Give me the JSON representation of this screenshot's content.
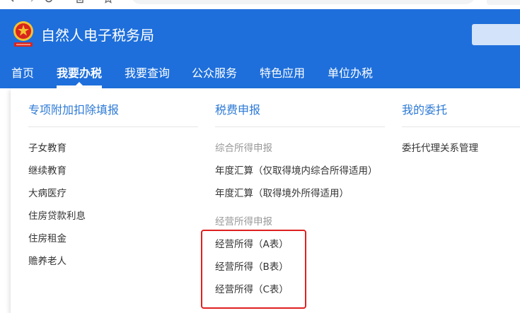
{
  "browser": {
    "icons": [
      "back-arrow-icon",
      "forward-arrow-icon",
      "reload-icon",
      "page-info-icon",
      "bookmark-star-icon"
    ]
  },
  "header": {
    "title": "自然人电子税务局",
    "logo_icon": "national-emblem-icon"
  },
  "nav": {
    "items": [
      {
        "label": "首页",
        "active": false
      },
      {
        "label": "我要办税",
        "active": true
      },
      {
        "label": "我要查询",
        "active": false
      },
      {
        "label": "公众服务",
        "active": false
      },
      {
        "label": "特色应用",
        "active": false
      },
      {
        "label": "单位办税",
        "active": false
      }
    ]
  },
  "menu": {
    "columns": [
      {
        "heading": "专项附加扣除填报",
        "items": [
          {
            "label": "子女教育"
          },
          {
            "label": "继续教育"
          },
          {
            "label": "大病医疗"
          },
          {
            "label": "住房贷款利息"
          },
          {
            "label": "住房租金"
          },
          {
            "label": "赡养老人"
          }
        ]
      },
      {
        "heading": "税费申报",
        "groups": [
          {
            "label": "综合所得申报",
            "items": [
              {
                "label": "年度汇算（仅取得境内综合所得适用）"
              },
              {
                "label": "年度汇算（取得境外所得适用）"
              }
            ]
          },
          {
            "label": "经营所得申报",
            "items": [
              {
                "label": "经营所得（A表）"
              },
              {
                "label": "经营所得（B表）"
              },
              {
                "label": "经营所得（C表）"
              }
            ]
          }
        ]
      },
      {
        "heading": "我的委托",
        "items": [
          {
            "label": "委托代理关系管理"
          }
        ]
      }
    ]
  },
  "colors": {
    "header_bg": "#1e6fdb",
    "heading": "#2d7ad6",
    "text": "#333333",
    "group_text": "#999999",
    "highlight_box": "#e02020"
  }
}
